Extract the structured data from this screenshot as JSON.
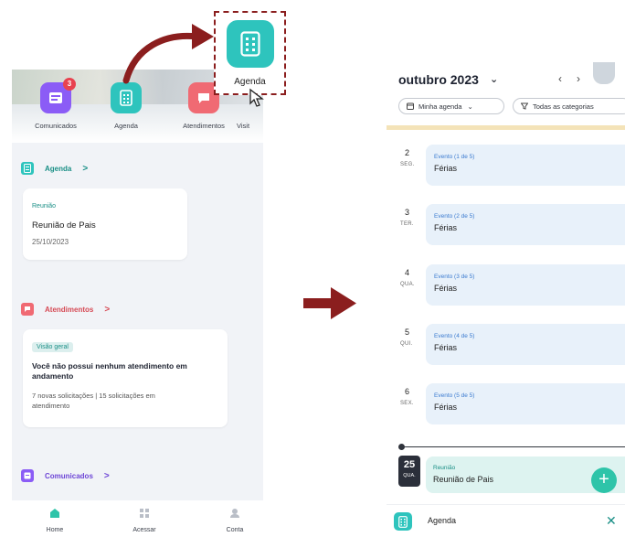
{
  "left": {
    "shortcuts": [
      {
        "label": "Comunicados",
        "badge": "3",
        "icon": "newspaper-icon",
        "color": "#8b5cf6"
      },
      {
        "label": "Agenda",
        "icon": "agenda-icon",
        "color": "#2ec4bd"
      },
      {
        "label": "Atendimentos",
        "icon": "chat-icon",
        "color": "#f06a73"
      },
      {
        "label": "Visit"
      }
    ],
    "callout": {
      "label": "Agenda",
      "icon": "agenda-icon"
    },
    "agenda_section": {
      "title": "Agenda",
      "chevron": ">",
      "card": {
        "category": "Reunião",
        "title": "Reunião de Pais",
        "date": "25/10/2023"
      }
    },
    "atendimentos_section": {
      "title": "Atendimentos",
      "chevron": ">",
      "card": {
        "pill": "Visão geral",
        "message": "Você não possui nenhum atendimento em andamento",
        "summary": "7 novas solicitações | 15 solicitações em atendimento"
      }
    },
    "comunicados_section": {
      "title": "Comunicados",
      "chevron": ">"
    },
    "bottom_nav": [
      {
        "label": "Home",
        "icon": "home-icon"
      },
      {
        "label": "Acessar",
        "icon": "grid-icon"
      },
      {
        "label": "Conta",
        "icon": "user-icon"
      }
    ]
  },
  "right": {
    "month": "outubro 2023",
    "month_chevron": "⌄",
    "prev": "‹",
    "next": "›",
    "filters": [
      {
        "label": "Minha agenda",
        "icon": "calendar-icon"
      },
      {
        "label": "Todas as categorias",
        "icon": "filter-icon"
      }
    ],
    "days": [
      {
        "num": "2",
        "abbr": "SEG.",
        "event_line": "Evento (1 de 5)",
        "title": "Férias"
      },
      {
        "num": "3",
        "abbr": "TER.",
        "event_line": "Evento (2 de 5)",
        "title": "Férias"
      },
      {
        "num": "4",
        "abbr": "QUA.",
        "event_line": "Evento (3 de 5)",
        "title": "Férias"
      },
      {
        "num": "5",
        "abbr": "QUI.",
        "event_line": "Evento (4 de 5)",
        "title": "Férias"
      },
      {
        "num": "6",
        "abbr": "SEX.",
        "event_line": "Evento (5 de 5)",
        "title": "Férias"
      }
    ],
    "today": {
      "num": "25",
      "abbr": "QUA.",
      "category": "Reunião",
      "title": "Reunião de Pais"
    },
    "fab": "+",
    "sheet": {
      "title": "Agenda",
      "close": "✕"
    }
  },
  "colors": {
    "teal": "#2ec4bd",
    "arrow": "#8b1e1e",
    "purple": "#8b5cf6",
    "coral": "#f06a73"
  }
}
